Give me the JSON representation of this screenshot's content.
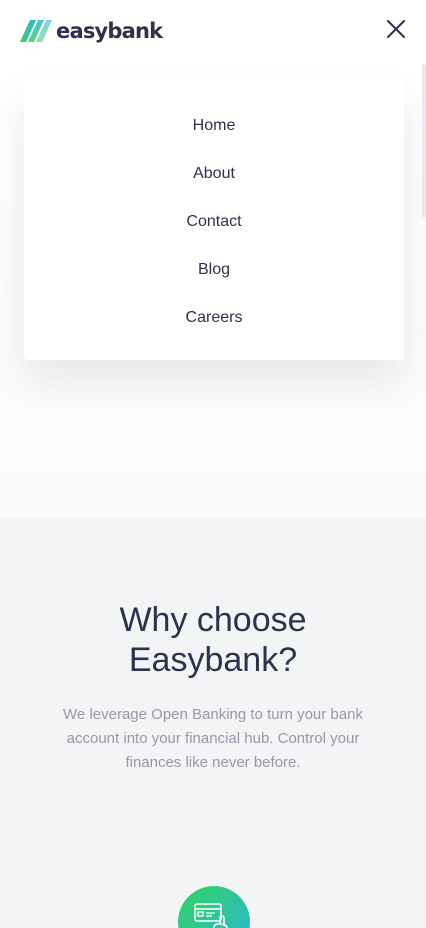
{
  "header": {
    "logo_text": "easybank",
    "close_icon": "close-icon",
    "logo_colors": [
      "#33d35e",
      "#2ab6d9"
    ]
  },
  "nav": {
    "items": [
      {
        "label": "Home"
      },
      {
        "label": "About"
      },
      {
        "label": "Contact"
      },
      {
        "label": "Blog"
      },
      {
        "label": "Careers"
      }
    ]
  },
  "why": {
    "title": "Why choose Easybank?",
    "description": "We leverage Open Banking to turn your bank account into your financial hub. Control your finances like never before.",
    "feature_icon": "online-banking-icon"
  },
  "colors": {
    "dark_blue": "#2d314d",
    "grayish_blue": "#9698a6",
    "lime_green": "#33d35e",
    "bright_cyan": "#2ab6d9",
    "light_gray": "#f3f4f6"
  }
}
